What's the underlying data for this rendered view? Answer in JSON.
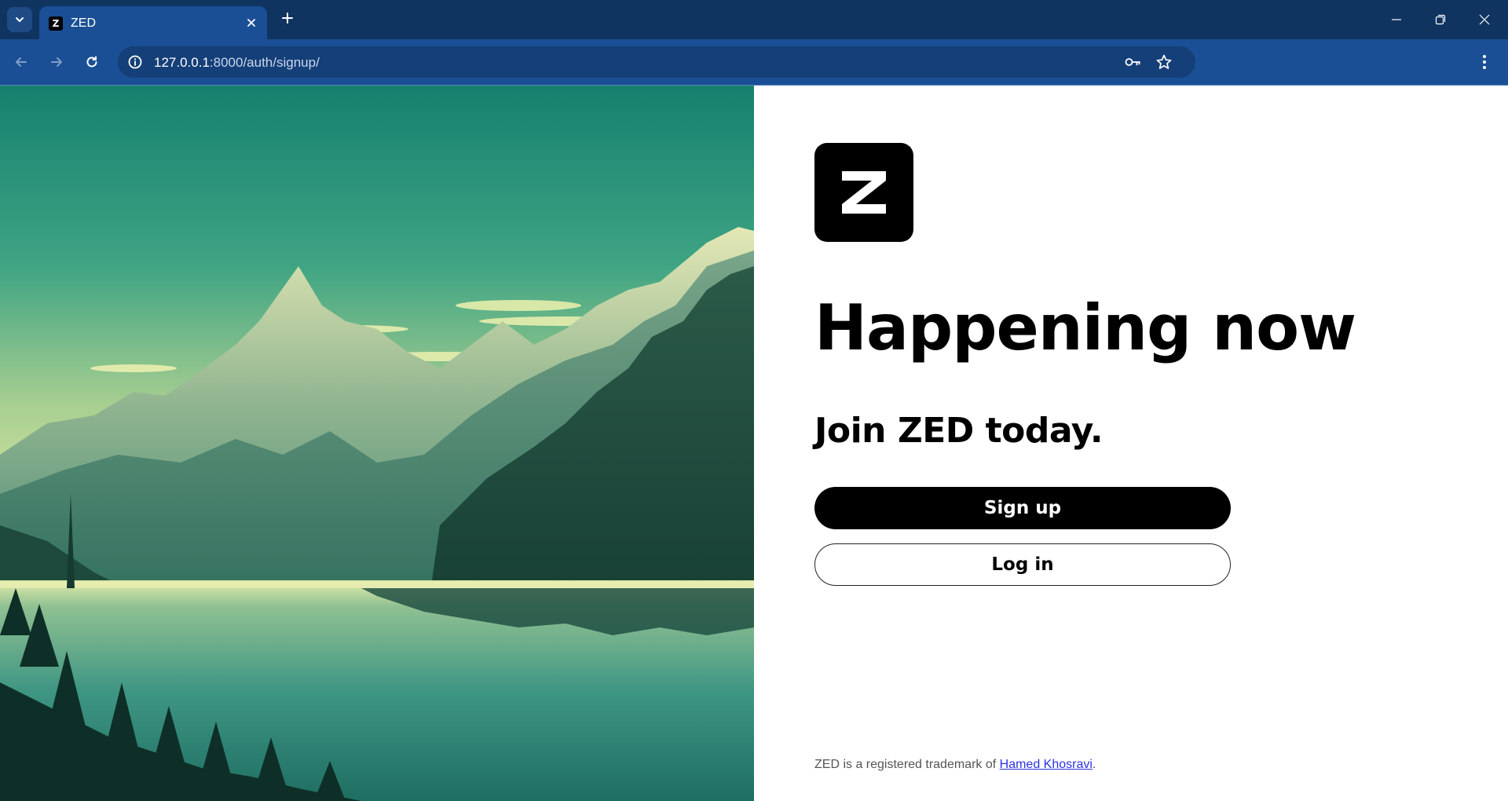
{
  "browser": {
    "tab": {
      "title": "ZED",
      "favicon_letter": "Z"
    },
    "address": {
      "host": "127.0.0.1",
      "path": ":8000/auth/signup/"
    },
    "icons": {
      "tab_search": "chevron-down-icon",
      "tab_close": "close-icon",
      "new_tab": "plus-icon",
      "minimize": "minimize-icon",
      "restore": "restore-icon",
      "close_window": "close-icon",
      "back": "arrow-left-icon",
      "forward": "arrow-right-icon",
      "reload": "reload-icon",
      "site_info": "info-icon",
      "password": "key-icon",
      "bookmark": "star-icon",
      "menu": "kebab-icon"
    }
  },
  "page": {
    "logo_letter": "Z",
    "headline": "Happening now",
    "subheading": "Join ZED today.",
    "signup_label": "Sign up",
    "login_label": "Log in",
    "footer": {
      "prefix": "ZED is a registered trademark of ",
      "link_text": "Hamed Khosravi",
      "suffix": "."
    }
  },
  "colors": {
    "chrome_frame": "#0f3460",
    "chrome_toolbar": "#1a4f95",
    "primary_button": "#000000",
    "link": "#2b33e0"
  }
}
